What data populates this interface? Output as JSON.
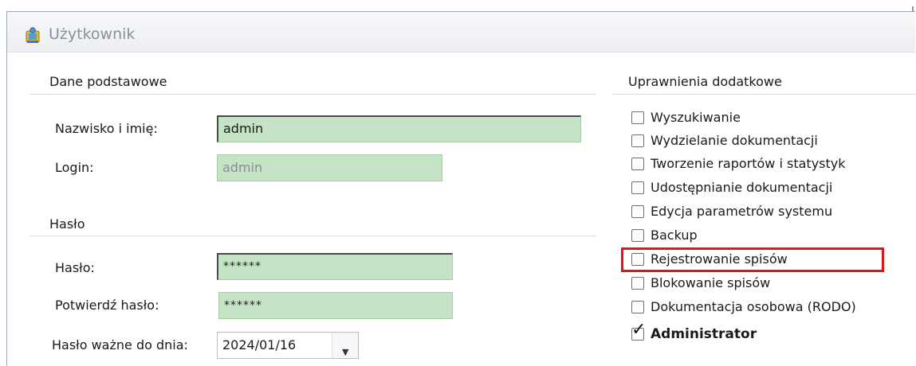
{
  "window": {
    "title": "Użytkownik"
  },
  "basic": {
    "section_title": "Dane podstawowe",
    "name_label": "Nazwisko i imię:",
    "name_value": "admin",
    "login_label": "Login:",
    "login_value": "admin"
  },
  "password": {
    "section_title": "Hasło",
    "password_label": "Hasło:",
    "password_value": "******",
    "confirm_label": "Potwierdź hasło:",
    "confirm_value": "******",
    "valid_until_label": "Hasło ważne do dnia:",
    "valid_until_value": "2024/01/16"
  },
  "permissions": {
    "section_title": "Uprawnienia dodatkowe",
    "items": [
      {
        "label": "Wyszukiwanie",
        "checked": false
      },
      {
        "label": "Wydzielanie dokumentacji",
        "checked": false
      },
      {
        "label": "Tworzenie raportów i statystyk",
        "checked": false
      },
      {
        "label": "Udostępnianie dokumentacji",
        "checked": false
      },
      {
        "label": "Edycja parametrów systemu",
        "checked": false
      },
      {
        "label": "Backup",
        "checked": false
      },
      {
        "label": "Rejestrowanie spisów",
        "checked": false,
        "highlighted": true
      },
      {
        "label": "Blokowanie spisów",
        "checked": false
      },
      {
        "label": "Dokumentacja osobowa (RODO)",
        "checked": false
      },
      {
        "label": "Administrator",
        "checked": true
      }
    ]
  },
  "colors": {
    "field_bg": "#c5e3c5",
    "highlight": "#e2151b"
  },
  "icons": {
    "app": "user-card-icon",
    "dropdown": "chevron-down-icon",
    "check": "checkmark-icon"
  }
}
